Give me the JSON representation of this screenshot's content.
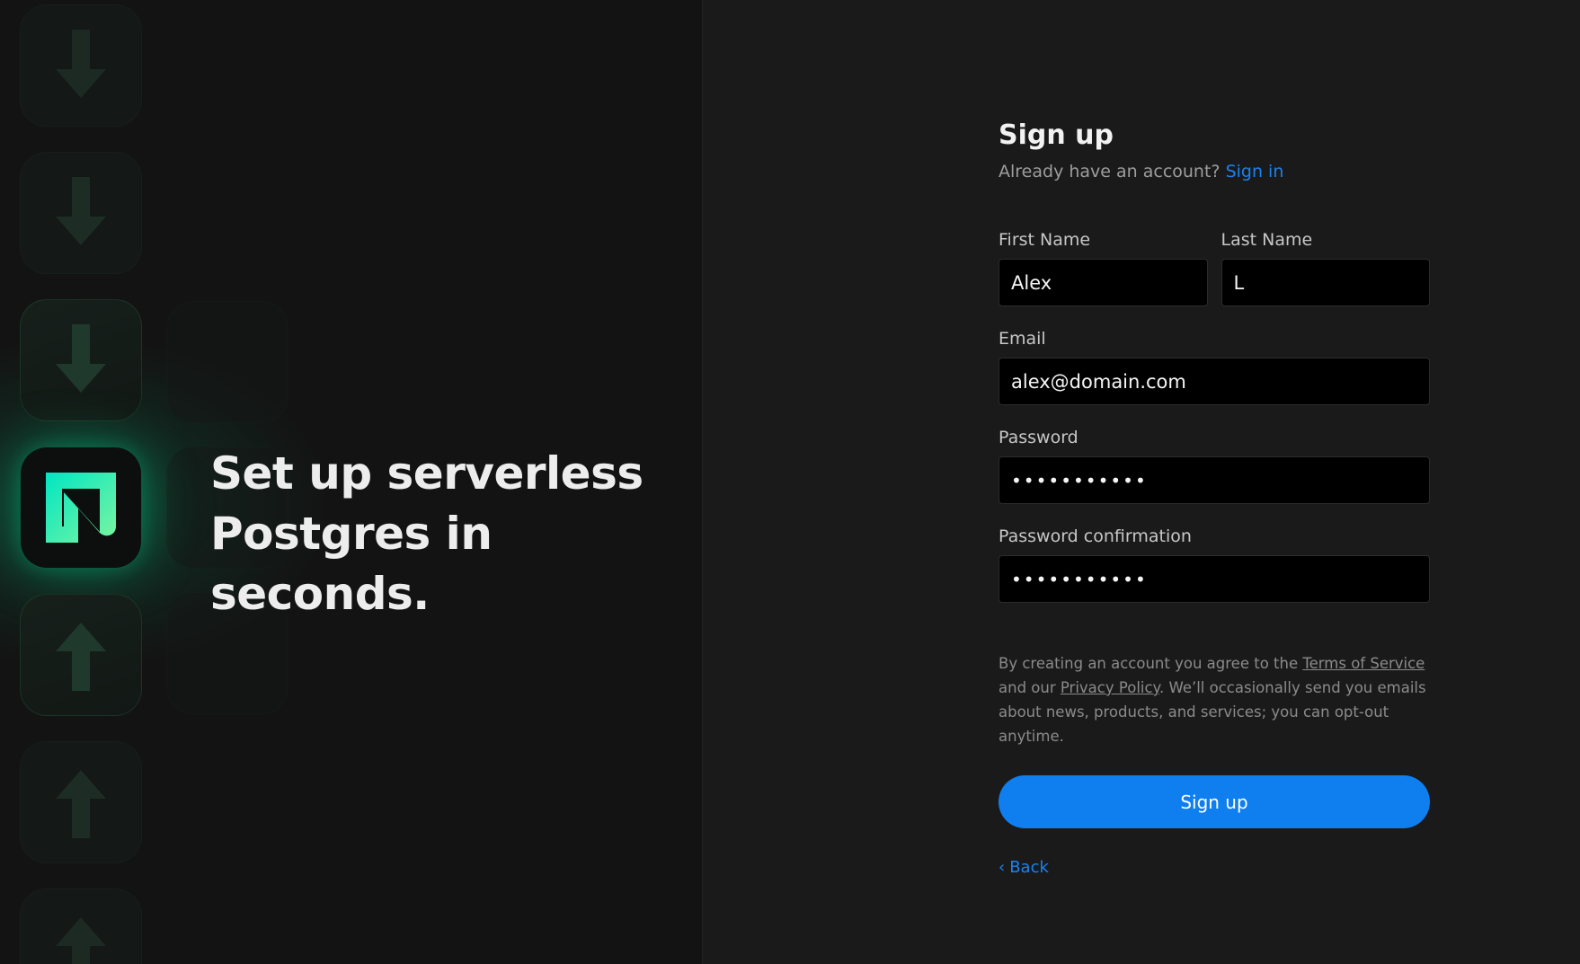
{
  "hero": {
    "line1": "Set up serverless",
    "line2": "Postgres in seconds."
  },
  "form": {
    "title": "Sign up",
    "subtitle_prefix": "Already have an account?",
    "signin_link": "Sign in",
    "first_name": {
      "label": "First Name",
      "value": "Alex"
    },
    "last_name": {
      "label": "Last Name",
      "value": "L"
    },
    "email": {
      "label": "Email",
      "value": "alex@domain.com"
    },
    "password": {
      "label": "Password",
      "value": "•••••••••••"
    },
    "password_confirmation": {
      "label": "Password confirmation",
      "value": "•••••••••••"
    },
    "legal": {
      "part1": "By creating an account you agree to the ",
      "terms_link": "Terms of Service",
      "part2": " and our ",
      "privacy_link": "Privacy Policy",
      "part3": ". We’ll occasionally send you emails about news, products, and services; you can opt-out anytime."
    },
    "submit_label": "Sign up",
    "back_label": "Back"
  },
  "colors": {
    "accent": "#0f7fef",
    "link": "#1a82f0",
    "brand_green": "#00e599",
    "background": "#1a1a1a"
  },
  "icons": [
    "arrow-down-icon",
    "arrow-up-icon",
    "neon-logo-icon",
    "chevron-left-icon"
  ]
}
